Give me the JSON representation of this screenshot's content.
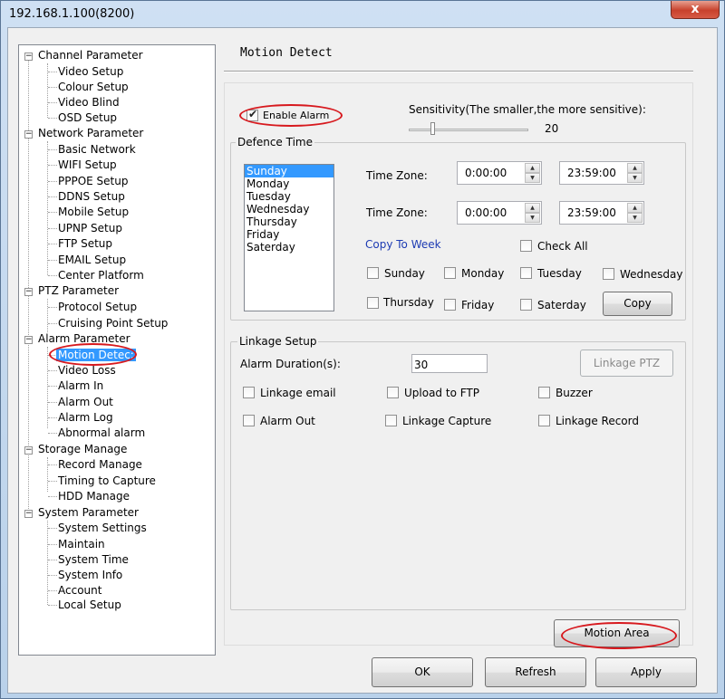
{
  "window": {
    "title": "192.168.1.100(8200)",
    "close_glyph": "x"
  },
  "tree": [
    {
      "label": "Channel Parameter",
      "children": [
        "Video Setup",
        "Colour Setup",
        "Video Blind",
        "OSD Setup"
      ]
    },
    {
      "label": "Network Parameter",
      "children": [
        "Basic Network",
        "WIFI Setup",
        "PPPOE Setup",
        "DDNS Setup",
        "Mobile Setup",
        "UPNP Setup",
        "FTP Setup",
        "EMAIL Setup",
        "Center Platform"
      ]
    },
    {
      "label": "PTZ Parameter",
      "children": [
        "Protocol Setup",
        "Cruising Point Setup"
      ]
    },
    {
      "label": "Alarm Parameter",
      "children": [
        "Motion Detec:",
        "Video Loss",
        "Alarm In",
        "Alarm Out",
        "Alarm Log",
        "Abnormal alarm"
      ]
    },
    {
      "label": "Storage Manage",
      "children": [
        "Record Manage",
        "Timing to Capture",
        "HDD Manage"
      ]
    },
    {
      "label": "System Parameter",
      "children": [
        "System Settings",
        "Maintain",
        "System Time",
        "System Info",
        "Account",
        "Local Setup"
      ]
    }
  ],
  "expander_glyph": "−",
  "selected_tree_item": "Motion Detec:",
  "page_title": "Motion Detect",
  "enable_alarm": {
    "label": "Enable Alarm",
    "checked": true
  },
  "sensitivity": {
    "label": "Sensitivity(The smaller,the more sensitive):",
    "value": "20"
  },
  "defence_time": {
    "title": "Defence Time",
    "days": [
      "Sunday",
      "Monday",
      "Tuesday",
      "Wednesday",
      "Thursday",
      "Friday",
      "Saterday"
    ],
    "selected_day": "Sunday",
    "time_zone_label": "Time Zone:",
    "zones": [
      {
        "start": "0:00:00",
        "end": "23:59:00"
      },
      {
        "start": "0:00:00",
        "end": "23:59:00"
      }
    ],
    "copy_to_week": "Copy To Week",
    "check_all": "Check All",
    "day_checks": [
      "Sunday",
      "Monday",
      "Tuesday",
      "Wednesday",
      "Thursday",
      "Friday",
      "Saterday"
    ],
    "copy_button": "Copy"
  },
  "linkage": {
    "title": "Linkage Setup",
    "alarm_duration_label": "Alarm Duration(s):",
    "alarm_duration_value": "30",
    "linkage_ptz_button": "Linkage PTZ",
    "options": [
      "Linkage email",
      "Upload to FTP",
      "Buzzer",
      "Alarm Out",
      "Linkage Capture",
      "Linkage Record"
    ]
  },
  "motion_area_button": "Motion Area",
  "footer": {
    "ok": "OK",
    "refresh": "Refresh",
    "apply": "Apply"
  },
  "annotation_color": "#d7191e",
  "selection_color": "#3399ff"
}
